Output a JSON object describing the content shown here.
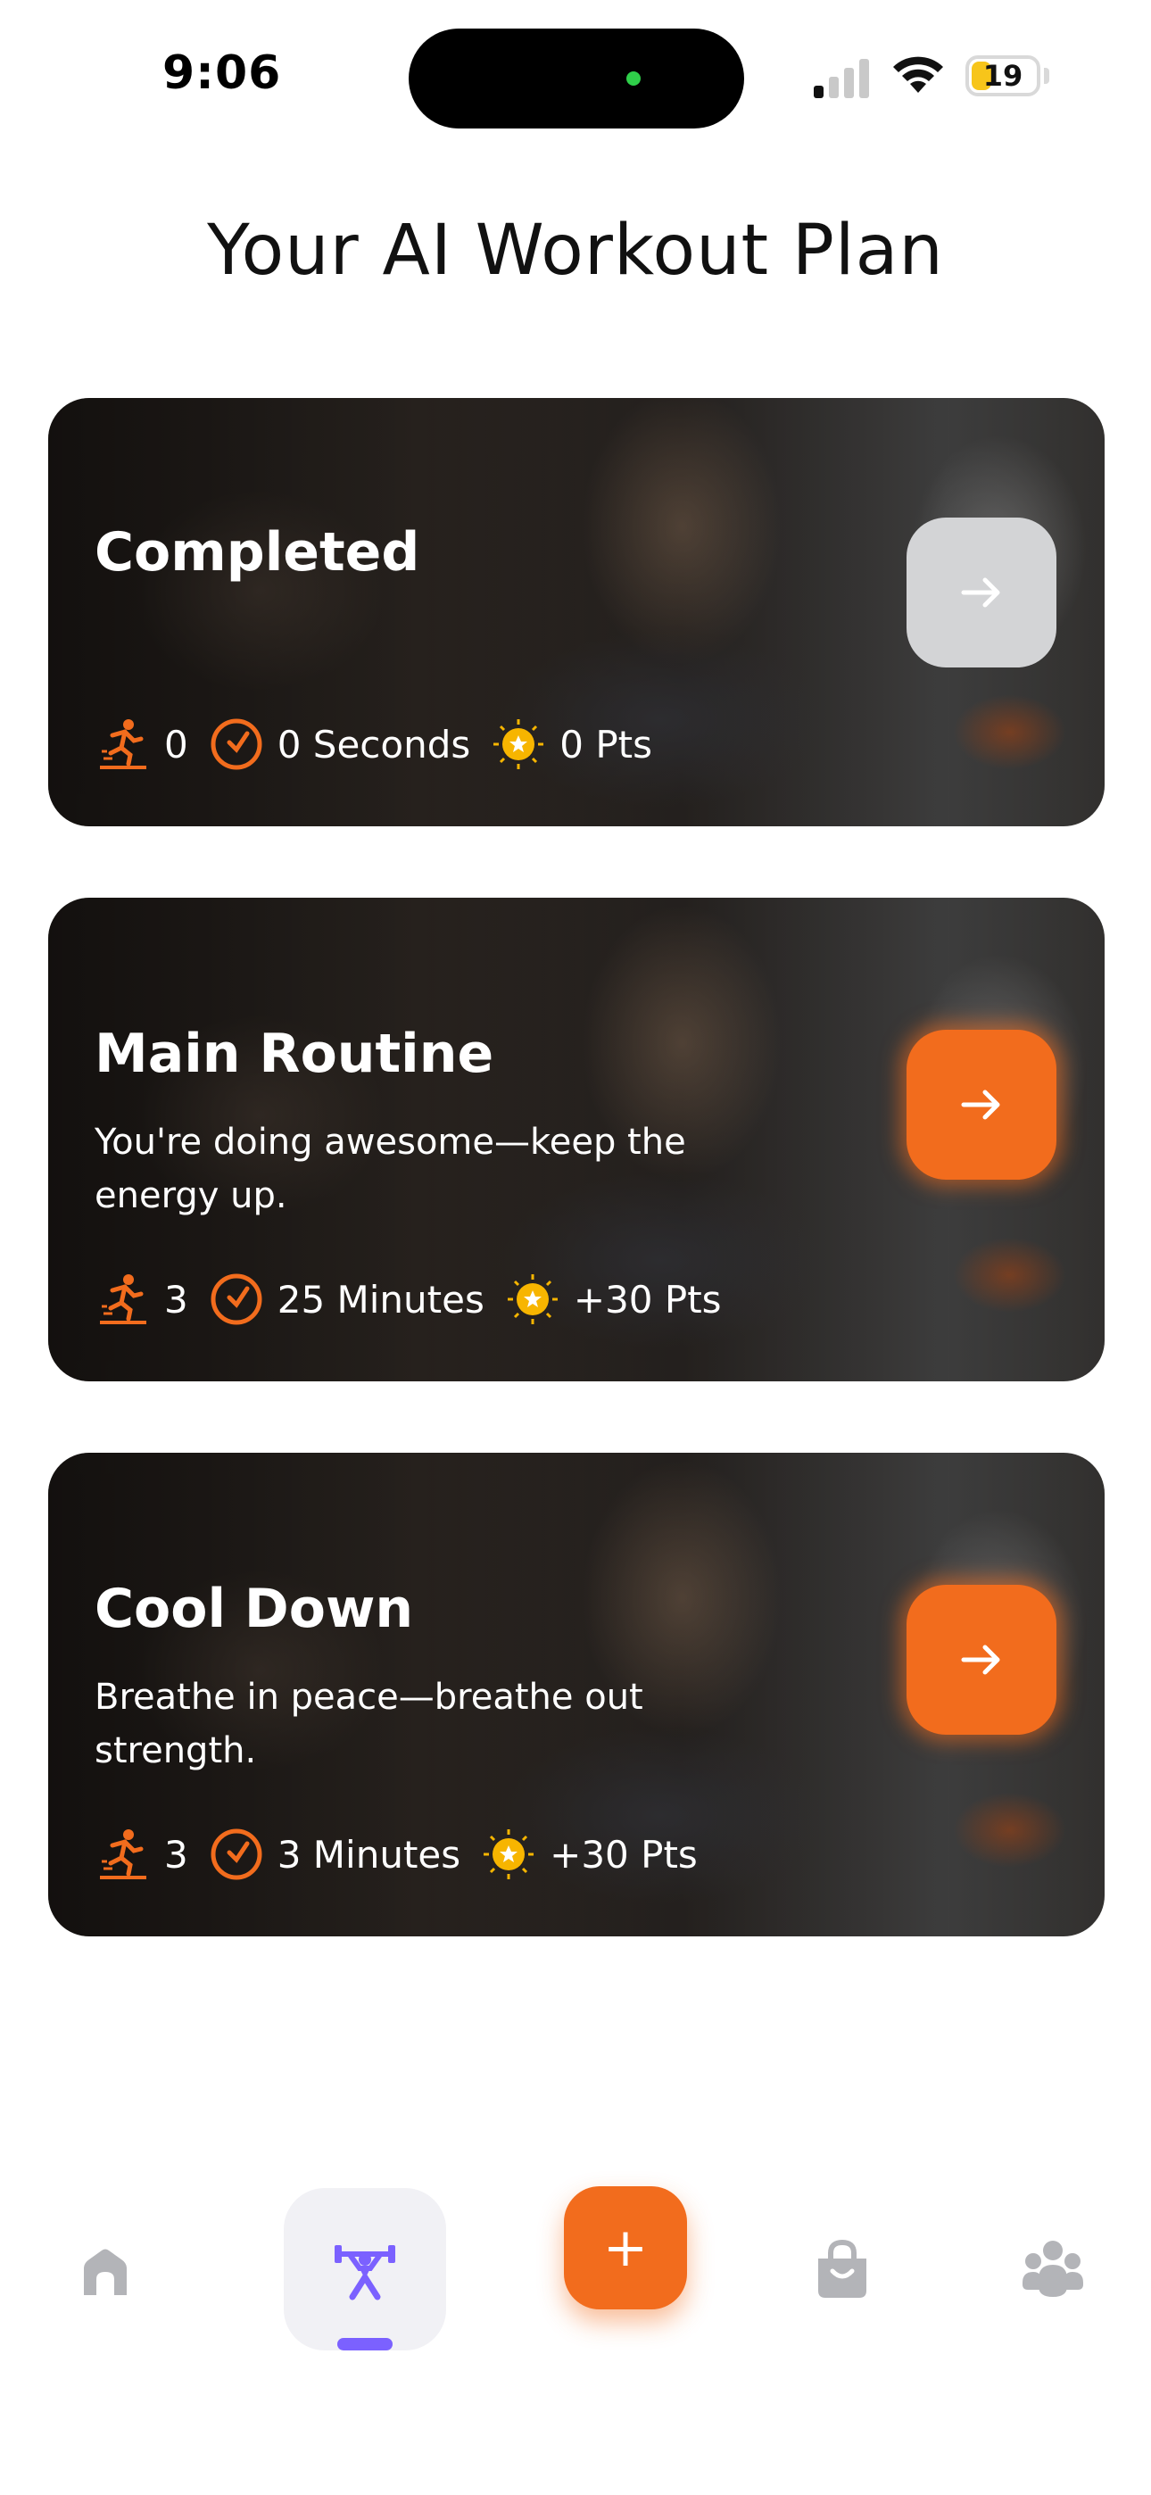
{
  "status_bar": {
    "time": "9:06",
    "battery": "19"
  },
  "page": {
    "title": "Your AI Workout Plan"
  },
  "cards": [
    {
      "title": "Completed",
      "subtitle": "",
      "exercises": "0",
      "duration": "0 Seconds",
      "points": "0 Pts",
      "button_state": "disabled"
    },
    {
      "title": "Main Routine",
      "subtitle": "You're doing awesome—keep the energy up.",
      "exercises": "3",
      "duration": "25 Minutes",
      "points": "+30 Pts",
      "button_state": "active"
    },
    {
      "title": "Cool Down",
      "subtitle": "Breathe in peace—breathe out strength.",
      "exercises": "3",
      "duration": "3 Minutes",
      "points": "+30 Pts",
      "button_state": "active"
    }
  ],
  "tabbar": {
    "items": [
      {
        "icon": "home-icon"
      },
      {
        "icon": "workout-icon",
        "active": true
      },
      {
        "icon": "add-icon",
        "label": "+"
      },
      {
        "icon": "shop-bag-icon"
      },
      {
        "icon": "community-icon"
      }
    ]
  },
  "colors": {
    "accent": "#f26c1d",
    "active_tab": "#7b61ff",
    "inactive_icon": "#b3b4b8",
    "disabled_button": "#d3d4d6"
  }
}
